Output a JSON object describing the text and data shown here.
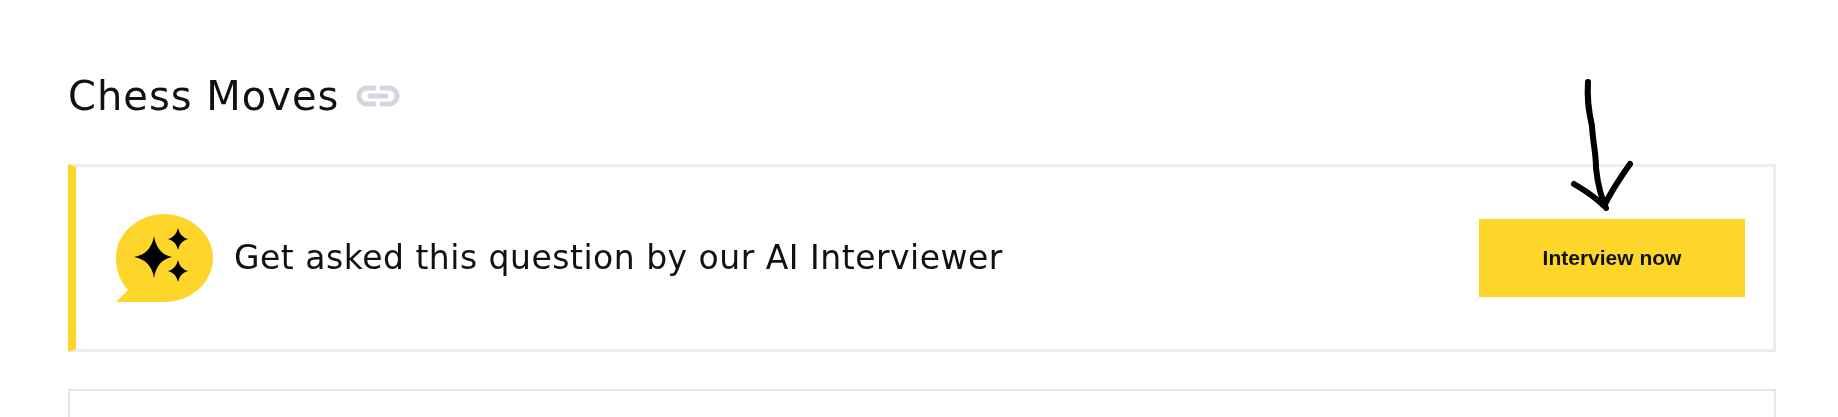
{
  "heading": {
    "title": "Chess Moves"
  },
  "banner": {
    "text": "Get asked this question by our AI Interviewer",
    "button": "Interview now"
  }
}
